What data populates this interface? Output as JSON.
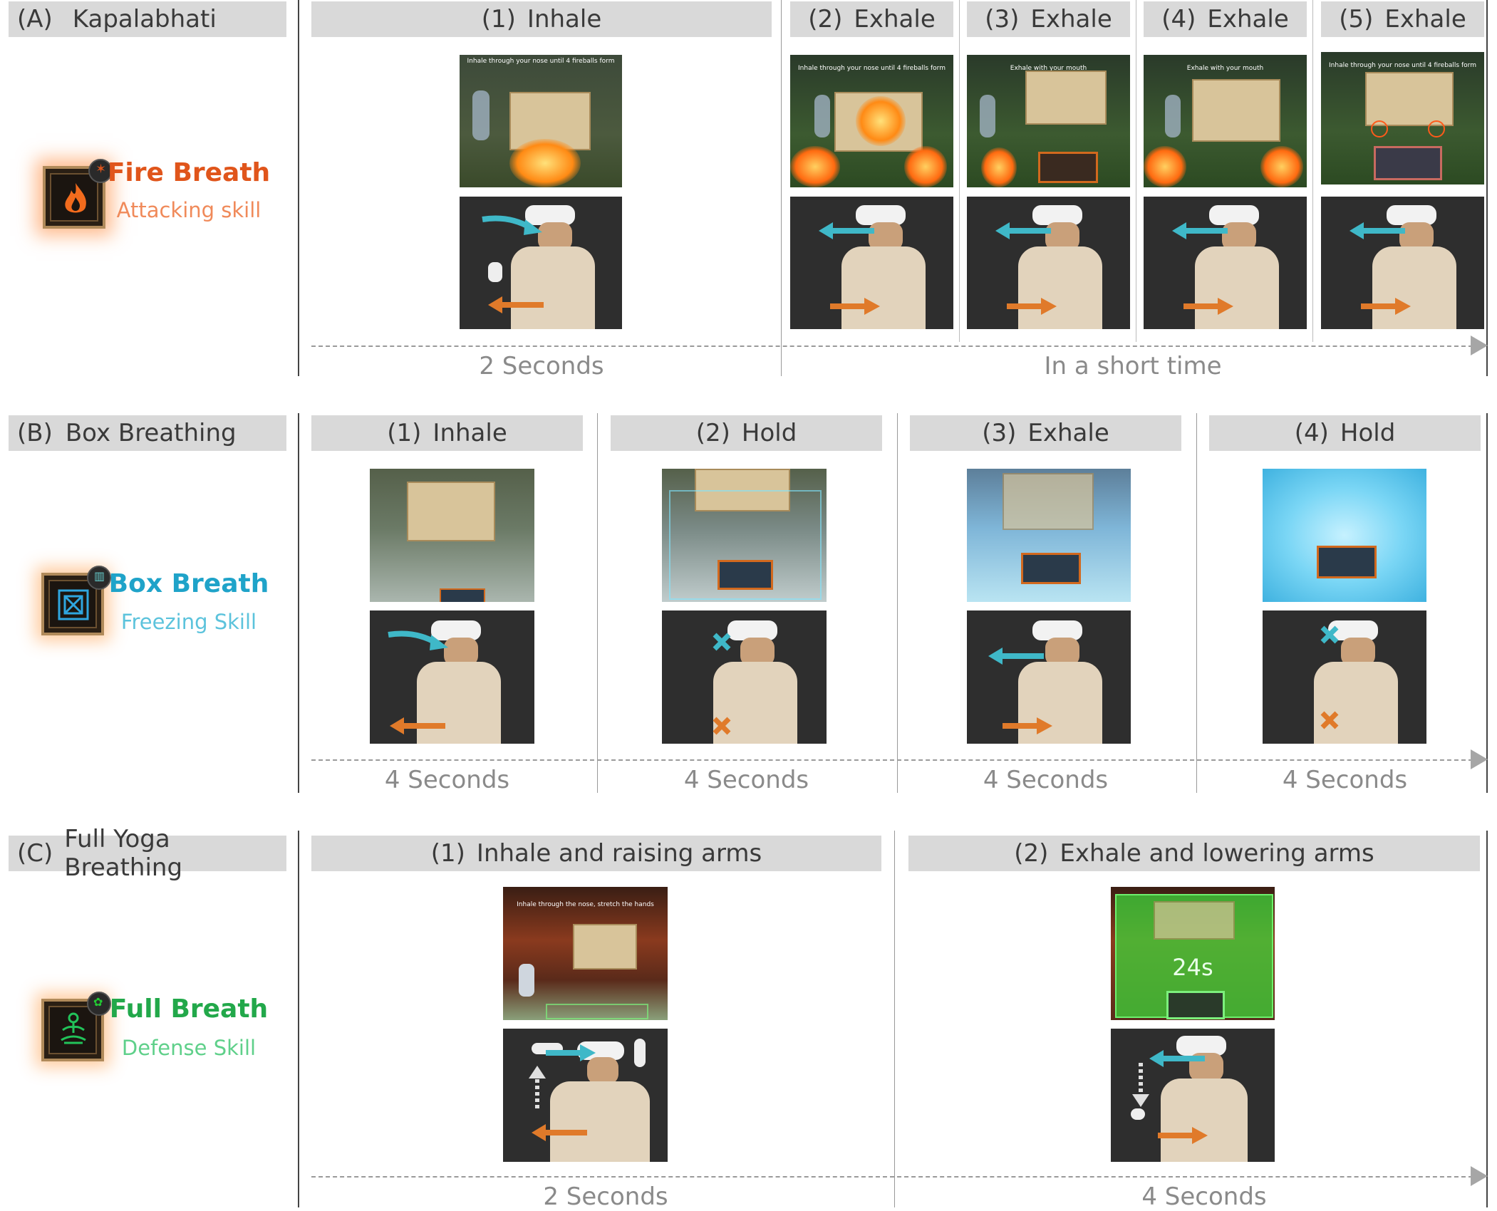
{
  "sections": [
    {
      "letter": "(A)",
      "name": "Kapalabhati",
      "skill": {
        "title": "Fire Breath",
        "subtitle": "Attacking skill",
        "title_color": "#e0551b",
        "subtitle_color": "#f08a5a",
        "icon": "flame-icon"
      },
      "steps": [
        {
          "num": "(1)",
          "label": "Inhale",
          "caption": "Inhale through your nose until 4 fireballs form"
        },
        {
          "num": "(2)",
          "label": "Exhale",
          "caption": "Inhale through your nose until 4 fireballs form"
        },
        {
          "num": "(3)",
          "label": "Exhale",
          "caption": "Exhale with your mouth"
        },
        {
          "num": "(4)",
          "label": "Exhale",
          "caption": "Exhale with your mouth"
        },
        {
          "num": "(5)",
          "label": "Exhale",
          "caption": "Inhale through your nose until 4 fireballs form"
        }
      ],
      "durations": [
        "2 Seconds",
        "In a short time"
      ]
    },
    {
      "letter": "(B)",
      "name": "Box Breathing",
      "skill": {
        "title": "Box Breath",
        "subtitle": "Freezing Skill",
        "title_color": "#1fa3c9",
        "subtitle_color": "#5cc3dc",
        "icon": "box-icon"
      },
      "steps": [
        {
          "num": "(1)",
          "label": "Inhale"
        },
        {
          "num": "(2)",
          "label": "Hold"
        },
        {
          "num": "(3)",
          "label": "Exhale"
        },
        {
          "num": "(4)",
          "label": "Hold"
        }
      ],
      "durations": [
        "4 Seconds",
        "4 Seconds",
        "4 Seconds",
        "4 Seconds"
      ]
    },
    {
      "letter": "(C)",
      "name": "Full Yoga Breathing",
      "skill": {
        "title": "Full Breath",
        "subtitle": "Defense Skill",
        "title_color": "#22a84a",
        "subtitle_color": "#5fd08a",
        "icon": "meditation-icon"
      },
      "steps": [
        {
          "num": "(1)",
          "label": "Inhale and raising arms",
          "caption": "Inhale through the nose, stretch the hands"
        },
        {
          "num": "(2)",
          "label": "Exhale and lowering arms",
          "timer": "24s"
        }
      ],
      "durations": [
        "2 Seconds",
        "4 Seconds"
      ]
    }
  ],
  "colors": {
    "inhale_arrow": "#3fb8c8",
    "exhale_arrow": "#e07a2a",
    "header_bg": "#d9d9d9",
    "timeline": "#9a9a9a"
  }
}
